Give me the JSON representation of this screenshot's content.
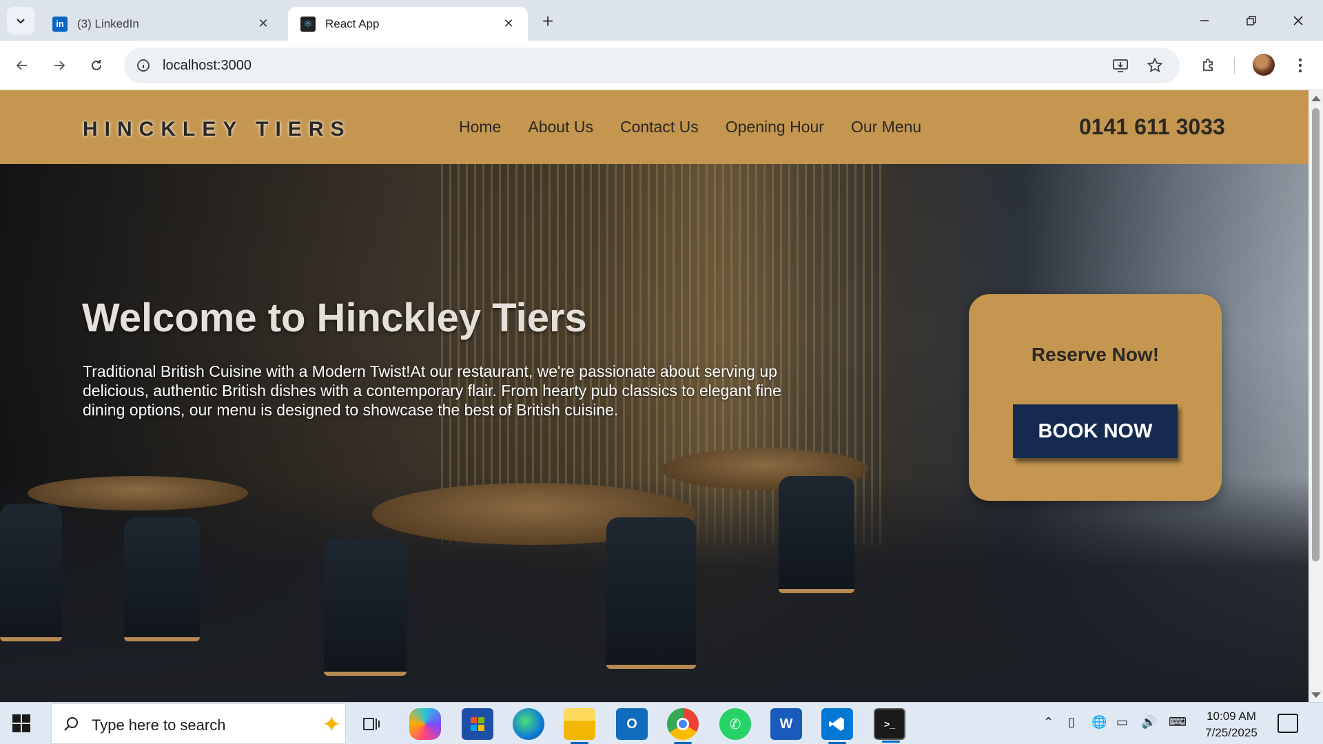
{
  "browser": {
    "tabs": [
      {
        "title": "(3) LinkedIn",
        "favicon": "linkedin-icon",
        "active": false
      },
      {
        "title": "React App",
        "favicon": "react-icon",
        "active": true
      }
    ],
    "url": "localhost:3000"
  },
  "site": {
    "logo": "HINCKLEY TIERS",
    "nav": [
      "Home",
      "About Us",
      "Contact Us",
      "Opening Hour",
      "Our Menu"
    ],
    "phone": "0141 611 3033",
    "hero_title": "Welcome to Hinckley Tiers",
    "hero_description": "Traditional British Cuisine with a Modern Twist!At our restaurant, we're passionate about serving up delicious, authentic British dishes with a contemporary flair. From hearty pub classics to elegant fine dining options, our menu is designed to showcase the best of British cuisine.",
    "reserve_title": "Reserve Now!",
    "book_button": "BOOK NOW"
  },
  "taskbar": {
    "search_placeholder": "Type here to search",
    "time": "10:09 AM",
    "date": "7/25/2025"
  },
  "colors": {
    "header_bg": "#c4964f",
    "book_button_bg": "#152a4e",
    "text_dark": "#2b2723"
  }
}
